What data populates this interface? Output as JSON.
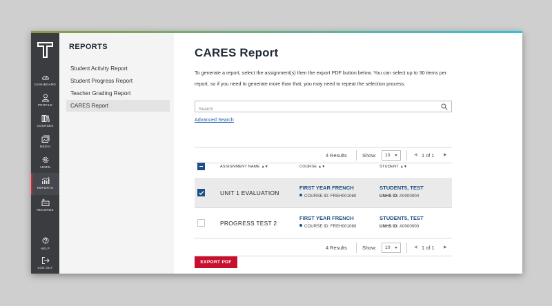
{
  "colors": {
    "sidebar_bg": "#3a3c40",
    "accent_red": "#c8102e",
    "accent_navy": "#1d4f86",
    "subnav_bg": "#f4f4f4"
  },
  "rail": {
    "items": [
      {
        "label": "DASHBOARD",
        "icon": "gauge-icon"
      },
      {
        "label": "PROFILE",
        "icon": "person-icon"
      },
      {
        "label": "COURSES",
        "icon": "books-icon"
      },
      {
        "label": "MEDIA",
        "icon": "media-icon"
      },
      {
        "label": "ADMIN",
        "icon": "gear-icon"
      },
      {
        "label": "REPORTS",
        "icon": "chart-icon"
      },
      {
        "label": "RECORDS",
        "icon": "records-icon"
      }
    ],
    "help": "HELP",
    "logout": "LOG OUT"
  },
  "subnav": {
    "title": "REPORTS",
    "items": [
      "Student Activity Report",
      "Student Progress Report",
      "Teacher Grading Report",
      "CARES Report"
    ]
  },
  "main": {
    "title": "CARES Report",
    "description": "To generate a report, select the assignment(s) then the export PDF button below. You can select up to 30 items per report, so if you need to generate more than that, you may need to repeat the selection process.",
    "search_placeholder": "Search",
    "advanced_search": "Advanced Search",
    "pager": {
      "results": "4 Results",
      "show_label": "Show:",
      "show_value": "10",
      "page_info": "1 of 1"
    },
    "columns": [
      "ASSIGNMENT NAME",
      "COURSE",
      "STUDENT"
    ],
    "rows": [
      {
        "selected": true,
        "assignment": "UNIT 1 EVALUATION",
        "course": "FIRST YEAR FRENCH",
        "course_id_label": "COURSE ID:",
        "course_id": "FREH001060",
        "student": "STUDENT5, TEST",
        "unhs_label": "UNHS ID:",
        "unhs_id": "A0000000"
      },
      {
        "selected": false,
        "assignment": "PROGRESS TEST 2",
        "course": "FIRST YEAR FRENCH",
        "course_id_label": "COURSE ID:",
        "course_id": "FREH001060",
        "student": "STUDENT5, TEST",
        "unhs_label": "UNHS ID:",
        "unhs_id": "A0000000"
      }
    ],
    "export_label": "EXPORT PDF"
  }
}
